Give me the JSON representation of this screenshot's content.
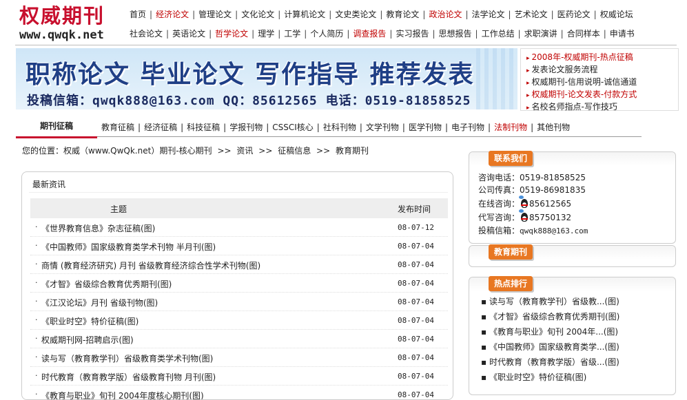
{
  "header": {
    "logo_text": "权威期刊",
    "logo_url": "www.qwqk.net",
    "nav_row1": [
      {
        "label": "首页",
        "highlight": false
      },
      {
        "label": "经济论文",
        "highlight": true
      },
      {
        "label": "管理论文",
        "highlight": false
      },
      {
        "label": "文化论文",
        "highlight": false
      },
      {
        "label": "计算机论文",
        "highlight": false
      },
      {
        "label": "文史类论文",
        "highlight": false
      },
      {
        "label": "教育论文",
        "highlight": false
      },
      {
        "label": "政治论文",
        "highlight": true
      },
      {
        "label": "法学论文",
        "highlight": false
      },
      {
        "label": "艺术论文",
        "highlight": false
      },
      {
        "label": "医药论文",
        "highlight": false
      },
      {
        "label": "权威论坛",
        "highlight": false
      }
    ],
    "nav_row2": [
      {
        "label": "社会论文",
        "highlight": false
      },
      {
        "label": "英语论文",
        "highlight": false
      },
      {
        "label": "哲学论文",
        "highlight": true
      },
      {
        "label": "理学",
        "highlight": false
      },
      {
        "label": "工学",
        "highlight": false
      },
      {
        "label": "个人简历",
        "highlight": false
      },
      {
        "label": "调查报告",
        "highlight": true
      },
      {
        "label": "实习报告",
        "highlight": false
      },
      {
        "label": "思想报告",
        "highlight": false
      },
      {
        "label": "工作总结",
        "highlight": false
      },
      {
        "label": "求职演讲",
        "highlight": false
      },
      {
        "label": "合同样本",
        "highlight": false
      },
      {
        "label": "申请书",
        "highlight": false
      }
    ]
  },
  "banner": {
    "headline": "职称论文  毕业论文  写作指导  推荐发表",
    "contact_line": "投稿信箱：qwqk888@163.com   QQ：85612565   电话：0519-81858525"
  },
  "side_links": [
    {
      "label": "2008年-权威期刊-热点征稿",
      "highlight": true
    },
    {
      "label": "发表论文服务流程",
      "highlight": false
    },
    {
      "label": "权威期刊-信用说明-诚信通道",
      "highlight": false
    },
    {
      "label": "权威期刊-论文发表-付款方式",
      "highlight": true
    },
    {
      "label": "名校名师指点-写作技巧",
      "highlight": false
    }
  ],
  "category_bar": {
    "title": "期刊征稿",
    "links": [
      {
        "label": "教育征稿",
        "highlight": false
      },
      {
        "label": "经济征稿",
        "highlight": false
      },
      {
        "label": "科技征稿",
        "highlight": false
      },
      {
        "label": "学报刊物",
        "highlight": false
      },
      {
        "label": "CSSCI核心",
        "highlight": false
      },
      {
        "label": "社科刊物",
        "highlight": false
      },
      {
        "label": "文学刊物",
        "highlight": false
      },
      {
        "label": "医学刊物",
        "highlight": false
      },
      {
        "label": "电子刊物",
        "highlight": false
      },
      {
        "label": "法制刊物",
        "highlight": true
      },
      {
        "label": "其他刊物",
        "highlight": false
      }
    ]
  },
  "breadcrumb": {
    "prefix": "您的位置：权威（www.QwQk.net）期刊-核心期刊",
    "items": [
      "资讯",
      "征稿信息",
      "教育期刊"
    ],
    "separator": ">>"
  },
  "news": {
    "title": "最新资讯",
    "col_subject": "主题",
    "col_date": "发布时间",
    "rows": [
      {
        "title": "《世界教育信息》杂志征稿(图)",
        "date": "08-07-12"
      },
      {
        "title": "《中国教师》国家级教育类学术刊物 半月刊(图)",
        "date": "08-07-04"
      },
      {
        "title": "商情 (教育经济研究) 月刊 省级教育经济综合性学术刊物(图)",
        "date": "08-07-04"
      },
      {
        "title": "《才智》省级综合教育优秀期刊(图)",
        "date": "08-07-04"
      },
      {
        "title": "《江汉论坛》月刊 省级刊物(图)",
        "date": "08-07-04"
      },
      {
        "title": "《职业时空》特价征稿(图)",
        "date": "08-07-04"
      },
      {
        "title": "权威期刊网-招聘启示(图)",
        "date": "08-07-04"
      },
      {
        "title": "读与写（教育教学刊）省级教育类学术刊物(图)",
        "date": "08-07-04"
      },
      {
        "title": "时代教育（教育教学版）省级教育刊物 月刊(图)",
        "date": "08-07-04"
      },
      {
        "title": "《教育与职业》旬刊 2004年度核心期刊(图)",
        "date": "08-07-04"
      }
    ]
  },
  "contact_panel": {
    "tag": "联系我们",
    "phone_label": "咨询电话：",
    "phone": "0519-81858525",
    "fax_label": "公司传真：",
    "fax": "0519-86981835",
    "online_label": "在线咨询：",
    "online_qq": "85612565",
    "agent_label": "代写咨询：",
    "agent_qq": "85750132",
    "email_label": "投稿信箱：",
    "email": "qwqk888@163.com"
  },
  "edu_panel": {
    "tag": "教育期刊"
  },
  "hot_panel": {
    "tag": "热点排行",
    "items": [
      "读与写（教育教学刊）省级教...(图)",
      "《才智》省级综合教育优秀期刊(图)",
      "《教育与职业》旬刊 2004年...(图)",
      "《中国教师》国家级教育类学...(图)",
      "时代教育（教育教学版）省级...(图)",
      "《职业时空》特价征稿(图)"
    ]
  },
  "colors": {
    "brand_red": "#c8102e",
    "link_red": "#c00000",
    "tag_orange": "#e87722",
    "banner_blue": "#1f3f86"
  }
}
